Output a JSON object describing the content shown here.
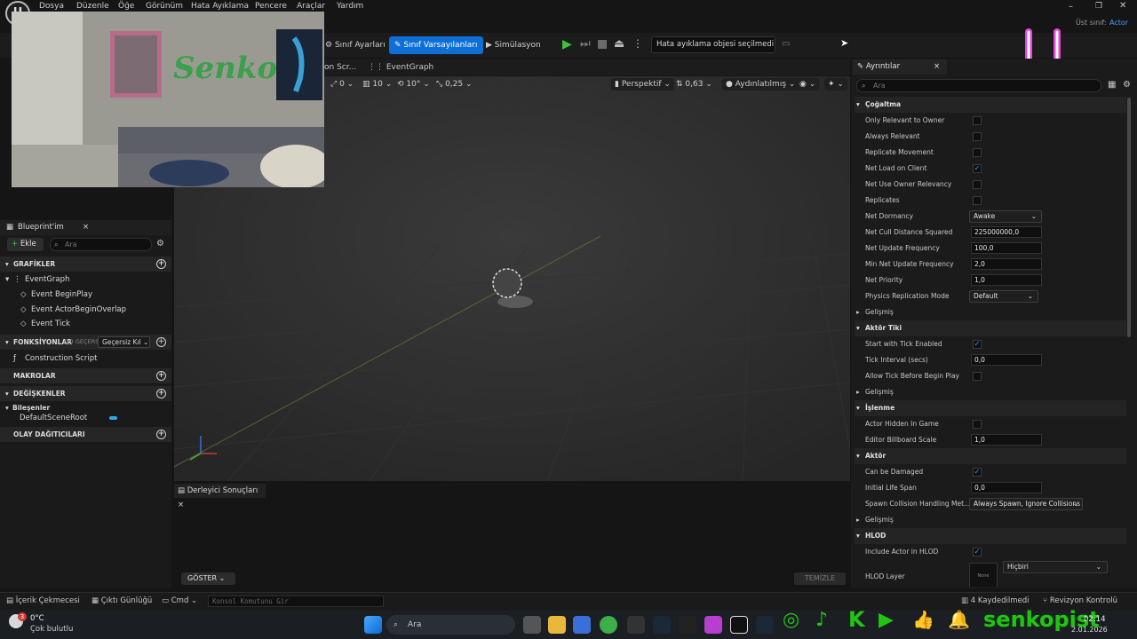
{
  "menubar": {
    "items": [
      "Dosya",
      "Düzenle",
      "Öğe",
      "Görünüm",
      "Hata Ayıklama",
      "Pencere",
      "Araçlar",
      "Yardım"
    ],
    "parent_class_label": "Üst sınıf:",
    "parent_class_value": "Actor"
  },
  "toolbar": {
    "class_settings": "Sınıf Ayarları",
    "class_defaults": "Sınıf Varsayılanları",
    "simulation": "Simülasyon",
    "debug_object": "Hata ayıklama objesi seçilmedi"
  },
  "tabs": {
    "construction_script": "on Scr...",
    "event_graph": "EventGraph",
    "details": "Ayrıntılar"
  },
  "viewport_toolbar": {
    "grid_snap": "0",
    "grid_size": "10",
    "rotation_snap": "10°",
    "scale_snap": "0,25",
    "perspective": "Perspektif",
    "fov": "0,63",
    "lighting": "Aydınlatılmış"
  },
  "my_blueprint": {
    "title": "Blueprint'im",
    "add_label": "Ekle",
    "search_placeholder": "Ara",
    "graphs_section": "GRAFİKLER",
    "event_graph": "EventGraph",
    "events": [
      "Event BeginPlay",
      "Event ActorBeginOverlap",
      "Event Tick"
    ],
    "functions_section": "FONKSİYONLAR",
    "functions_count": "(19 GEÇERSİZ)",
    "override_label": "Geçersiz Kıl",
    "construction_script": "Construction Script",
    "macros_section": "MAKROLAR",
    "variables_section": "DEĞİŞKENLER",
    "components_label": "Bileşenler",
    "default_scene_root": "DefaultSceneRoot",
    "dispatchers_section": "OLAY DAĞITICILARI"
  },
  "compiler": {
    "tab": "Derleyici Sonuçları",
    "show_button": "GÖSTER",
    "clear_button": "TEMİZLE"
  },
  "details": {
    "search_placeholder": "Ara",
    "replication_section": "Çoğaltma",
    "only_relevant_to_owner": "Only Relevant to Owner",
    "always_relevant": "Always Relevant",
    "replicate_movement": "Replicate Movement",
    "net_load_on_client": "Net Load on Client",
    "net_use_owner_relevancy": "Net Use Owner Relevancy",
    "replicates": "Replicates",
    "net_dormancy": "Net Dormancy",
    "net_dormancy_value": "Awake",
    "net_cull_distance": "Net Cull Distance Squared",
    "net_cull_distance_value": "225000000,0",
    "net_update_frequency": "Net Update Frequency",
    "net_update_frequency_value": "100,0",
    "min_net_update_frequency": "Min Net Update Frequency",
    "min_net_update_frequency_value": "2,0",
    "net_priority": "Net Priority",
    "net_priority_value": "1,0",
    "physics_replication_mode": "Physics Replication Mode",
    "physics_replication_mode_value": "Default",
    "advanced": "Gelişmiş",
    "actor_tick_section": "Aktör Tiki",
    "start_with_tick": "Start with Tick Enabled",
    "tick_interval": "Tick Interval (secs)",
    "tick_interval_value": "0,0",
    "allow_tick_before": "Allow Tick Before Begin Play",
    "rendering_section": "İşlenme",
    "actor_hidden": "Actor Hidden In Game",
    "billboard_scale": "Editor Billboard Scale",
    "billboard_scale_value": "1,0",
    "actor_section": "Aktör",
    "can_be_damaged": "Can be Damaged",
    "initial_life_span": "Initial Life Span",
    "initial_life_span_value": "0,0",
    "spawn_collision": "Spawn Collision Handling Met...",
    "spawn_collision_value": "Always Spawn, Ignore Collisions",
    "hlod_section": "HLOD",
    "include_actor_hlod": "Include Actor in HLOD",
    "hlod_layer": "HLOD Layer",
    "hlod_layer_value": "Hiçbiri",
    "hlod_thumb": "None"
  },
  "statusbar": {
    "content_drawer": "İçerik Çekmecesi",
    "output_log": "Çıktı Günlüğü",
    "cmd": "Cmd",
    "console_placeholder": "Konsol Komutunu Gir",
    "unsaved": "4 Kaydedilmedi",
    "revision_control": "Revizyon Kontrolü"
  },
  "taskbar": {
    "temperature": "0°C",
    "weather": "Çok bulutlu",
    "search_placeholder": "Ara",
    "time": "02:14",
    "date": "2.01.2026",
    "weather_badge": "3"
  },
  "overlay": {
    "handle": "senkopist",
    "webcam_graffiti": "Senko"
  },
  "colors": {
    "accent": "#0e6fd6",
    "checkbox": "#4d9bff",
    "overlay_green": "#22c414",
    "overlay_pink": "#e646d8"
  }
}
